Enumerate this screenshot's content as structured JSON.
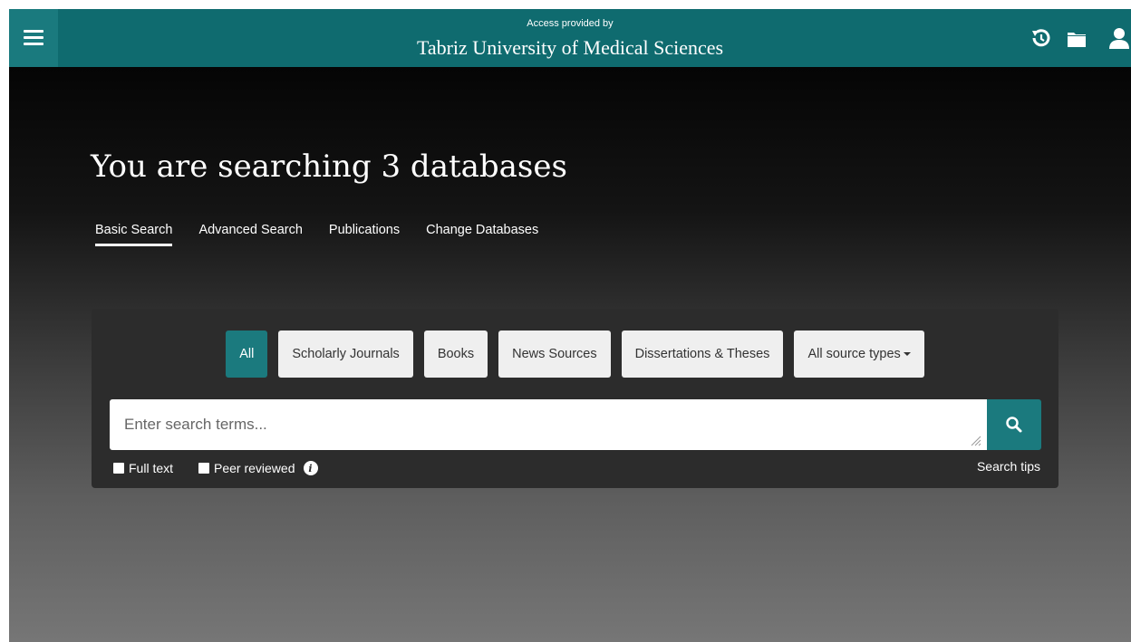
{
  "header": {
    "access_label": "Access provided by",
    "institution": "Tabriz University of Medical Sciences",
    "icons": [
      "menu-icon",
      "history-icon",
      "folder-icon",
      "user-icon"
    ]
  },
  "main": {
    "heading": "You are searching 3 databases",
    "tabs": [
      {
        "label": "Basic Search",
        "active": true
      },
      {
        "label": "Advanced Search",
        "active": false
      },
      {
        "label": "Publications",
        "active": false
      },
      {
        "label": "Change Databases",
        "active": false
      }
    ]
  },
  "search": {
    "filters": [
      {
        "label": "All",
        "active": true
      },
      {
        "label": "Scholarly Journals",
        "active": false
      },
      {
        "label": "Books",
        "active": false
      },
      {
        "label": "News Sources",
        "active": false
      },
      {
        "label": "Dissertations & Theses",
        "active": false
      },
      {
        "label": "All source types",
        "active": false
      }
    ],
    "placeholder": "Enter search terms...",
    "full_text_label": "Full text",
    "peer_reviewed_label": "Peer reviewed",
    "tips_label": "Search tips"
  },
  "colors": {
    "header_bg": "#0f6b6f",
    "accent": "#1b7a7e"
  }
}
